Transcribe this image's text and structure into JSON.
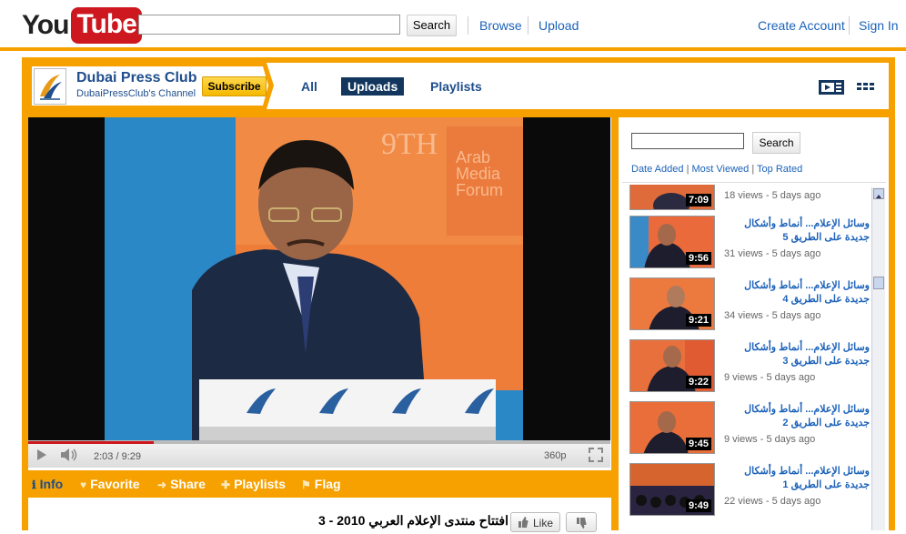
{
  "brand": {
    "you": "You",
    "tube": "Tube"
  },
  "masthead": {
    "search_button": "Search",
    "browse": "Browse",
    "upload": "Upload",
    "create_account": "Create Account",
    "sign_in": "Sign In"
  },
  "channel": {
    "name": "Dubai Press Club",
    "subtitle": "DubaiPressClub's Channel",
    "subscribe": "Subscribe",
    "tabs": [
      "All",
      "Uploads",
      "Playlists"
    ],
    "active_tab": "Uploads"
  },
  "player": {
    "time": "2:03 / 9:29",
    "quality": "360p",
    "progress_fraction": 0.216
  },
  "actions": {
    "info": "Info",
    "favorite": "Favorite",
    "share": "Share",
    "playlists": "Playlists",
    "flag": "Flag"
  },
  "video": {
    "title": "افتتاح منتدى الإعلام العربي 2010 - 3",
    "like": "Like"
  },
  "sidebar": {
    "search_button": "Search",
    "sort": [
      "Date Added",
      "Most Viewed",
      "Top Rated"
    ],
    "items": [
      {
        "title": "",
        "meta": "18 views - 5 days ago",
        "duration": "7:09"
      },
      {
        "title": "وسائل الإعلام... أنماط وأشكال جديدة على الطريق 5",
        "meta": "31 views - 5 days ago",
        "duration": "9:56"
      },
      {
        "title": "وسائل الإعلام... أنماط وأشكال جديدة على الطريق 4",
        "meta": "34 views - 5 days ago",
        "duration": "9:21"
      },
      {
        "title": "وسائل الإعلام... أنماط وأشكال جديدة على الطريق 3",
        "meta": "9 views - 5 days ago",
        "duration": "9:22"
      },
      {
        "title": "وسائل الإعلام... أنماط وأشكال جديدة على الطريق 2",
        "meta": "9 views - 5 days ago",
        "duration": "9:45"
      },
      {
        "title": "وسائل الإعلام... أنماط وأشكال جديدة على الطريق 1",
        "meta": "22 views - 5 days ago",
        "duration": "9:49"
      }
    ]
  },
  "colors": {
    "accent": "#f7a100",
    "brand_red": "#cc181e",
    "navy": "#12365e",
    "link": "#1c62b9"
  }
}
